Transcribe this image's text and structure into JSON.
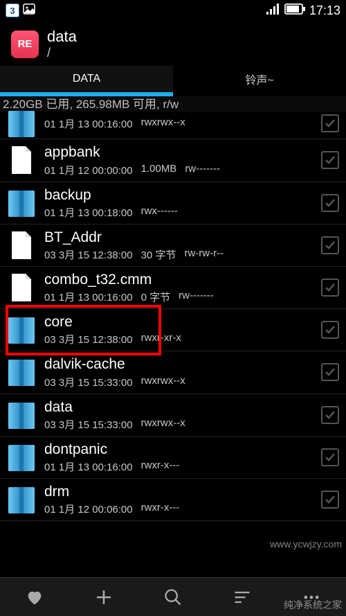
{
  "status": {
    "badge": "3",
    "time": "17:13"
  },
  "header": {
    "app_label": "RE",
    "title": "data",
    "path": "/"
  },
  "tabs": {
    "data": "DATA",
    "ringtones": "铃声~"
  },
  "storage": "2.20GB 已用, 265.98MB 可用, r/w",
  "items": [
    {
      "type": "folder",
      "name": "",
      "date": "01 1月 13 00:16:00",
      "size": "",
      "perm": "rwxrwx--x",
      "partial": true
    },
    {
      "type": "file",
      "name": "appbank",
      "date": "01 1月 12 00:00:00",
      "size": "1.00MB",
      "perm": "rw-------"
    },
    {
      "type": "folder",
      "name": "backup",
      "date": "01 1月 13 00:18:00",
      "size": "",
      "perm": "rwx------"
    },
    {
      "type": "file",
      "name": "BT_Addr",
      "date": "03 3月 15 12:38:00",
      "size": "30 字节",
      "perm": "rw-rw-r--"
    },
    {
      "type": "file",
      "name": "combo_t32.cmm",
      "date": "01 1月 13 00:16:00",
      "size": "0 字节",
      "perm": "rw-------"
    },
    {
      "type": "folder",
      "name": "core",
      "date": "03 3月 15 12:38:00",
      "size": "",
      "perm": "rwxr-xr-x",
      "highlighted": true
    },
    {
      "type": "folder",
      "name": "dalvik-cache",
      "date": "03 3月 15 15:33:00",
      "size": "",
      "perm": "rwxrwx--x"
    },
    {
      "type": "folder",
      "name": "data",
      "date": "03 3月 15 15:33:00",
      "size": "",
      "perm": "rwxrwx--x"
    },
    {
      "type": "folder",
      "name": "dontpanic",
      "date": "01 1月 13 00:16:00",
      "size": "",
      "perm": "rwxr-x---"
    },
    {
      "type": "folder",
      "name": "drm",
      "date": "01 1月 12 00:06:00",
      "size": "",
      "perm": "rwxr-x---"
    }
  ],
  "watermarks": {
    "w1": "www.ycwjzy.com",
    "w2": "纯净系统之家"
  },
  "icons": {
    "folder": "folder",
    "file": "file"
  }
}
